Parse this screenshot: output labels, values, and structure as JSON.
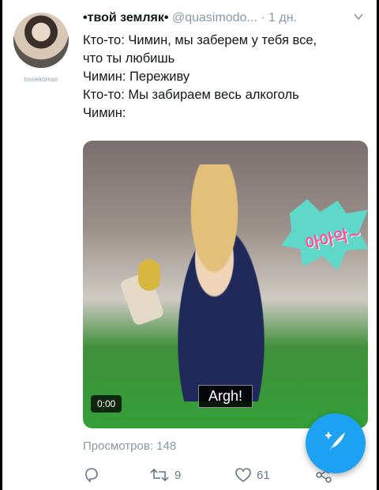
{
  "profile": {
    "avatar_caption": "lovvekorean",
    "name": "•твой земляк•",
    "handle": "@quasimodo...",
    "separator": "·",
    "time": "1 дн."
  },
  "tweet": {
    "lines": [
      "Кто-то: Чимин, мы заберем у тебя все,",
      "что ты любишь",
      "Чимин: Переживу",
      "Кто-то: Мы забираем весь алкоголь",
      "Чимин:"
    ]
  },
  "media": {
    "timecode": "0:00",
    "subtitle": "Argh!",
    "sticker_text": "아아악~"
  },
  "stats": {
    "views": "Просмотров: 148",
    "retweets": "9",
    "likes": "61"
  },
  "icons": {
    "reply": "reply-icon",
    "retweet": "retweet-icon",
    "like": "heart-icon",
    "share": "share-icon",
    "compose": "compose-icon",
    "menu": "chevron-down-icon"
  },
  "colors": {
    "accent": "#1da1f2",
    "muted": "#8899a6",
    "text": "#14171a"
  }
}
